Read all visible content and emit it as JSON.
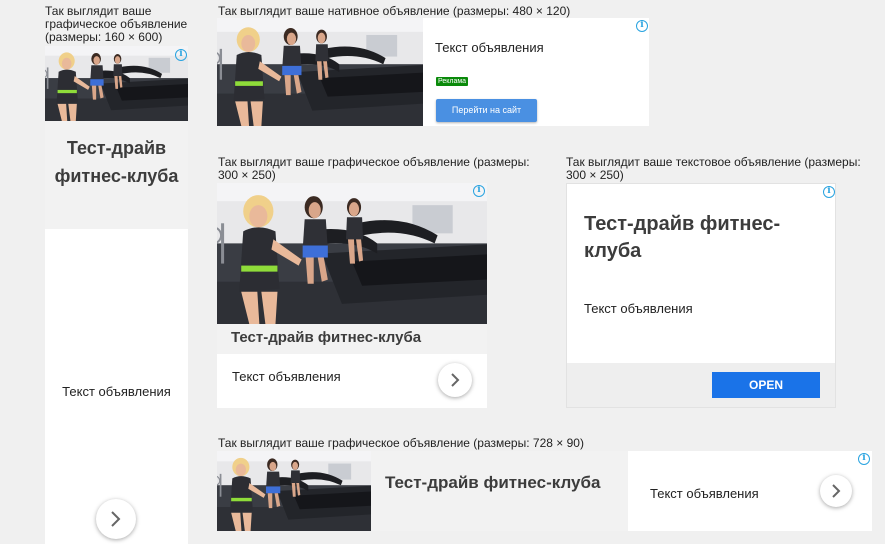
{
  "captions": {
    "sky": "Так выглядит ваше графическое объявление (размеры: 160 × 600)",
    "native": "Так выглядит ваше нативное объявление (размеры: 480 × 120)",
    "rect_graphic": "Так выглядит ваше графическое объявление (размеры: 300 × 250)",
    "rect_text": "Так выглядит ваше текстовое объявление (размеры: 300 × 250)",
    "leaderboard": "Так выглядит ваше графическое объявление (размеры: 728 × 90)"
  },
  "ad": {
    "headline": "Тест-драйв фитнес-клуба",
    "body": "Текст объявления",
    "badge": "Реклама",
    "cta_native": "Перейти на сайт",
    "cta_text": "OPEN",
    "adchoices_glyph": "i"
  },
  "icons": {
    "adchoices": "adchoices-info-icon",
    "arrow": "chevron-right-icon"
  },
  "colors": {
    "background": "#f0f0f0",
    "headline_band": "#f2f2f2",
    "badge": "#0a8a0a",
    "cta_native": "#4a90e2",
    "cta_text": "#1a73e8",
    "adchoices": "#29a3e0"
  }
}
